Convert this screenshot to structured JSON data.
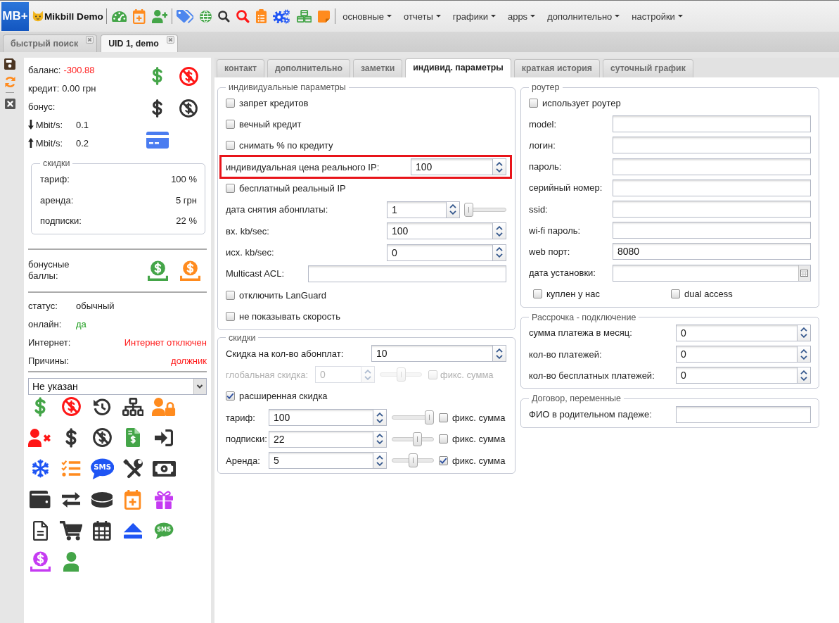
{
  "header": {
    "logo": "MB+",
    "title": "Mikbill Demo",
    "menus": [
      "основные",
      "отчеты",
      "графики",
      "apps",
      "дополнительно",
      "настройки"
    ]
  },
  "window_tabs": [
    {
      "label": "быстрый поиск",
      "selected": false
    },
    {
      "label": "UID 1, demo",
      "selected": true
    }
  ],
  "summary": {
    "balance": {
      "label": "баланс:",
      "value": "-300.88"
    },
    "credit": {
      "label": "кредит:",
      "value": "0.00 грн"
    },
    "bonus": {
      "label": "бонус:"
    },
    "speed_down": {
      "label": "Mbit/s:",
      "value": "0.1"
    },
    "speed_up": {
      "label": "Mbit/s:",
      "value": "0.2"
    },
    "discounts": {
      "legend": "скидки",
      "rows": [
        {
          "label": "тариф:",
          "value": "100 %"
        },
        {
          "label": "аренда:",
          "value": "5 грн"
        },
        {
          "label": "подписки:",
          "value": "22 %"
        }
      ]
    },
    "bonus_points": {
      "label": "бонусные баллы:"
    },
    "status": {
      "label": "статус:",
      "value": "обычный"
    },
    "online": {
      "label": "онлайн:",
      "value": "да"
    },
    "internet": {
      "label": "Интернет:",
      "value": "Интернет отключен"
    },
    "reasons": {
      "label": "Причины:",
      "value": "должник"
    },
    "tariff_select": {
      "value": "Не указан"
    },
    "icon_grid": {
      "sms_labels": [
        "SMS",
        "SMS"
      ]
    }
  },
  "tabs": [
    {
      "label": "контакт",
      "selected": false
    },
    {
      "label": "дополнительно",
      "selected": false
    },
    {
      "label": "заметки",
      "selected": false
    },
    {
      "label": "индивид. параметры",
      "selected": true
    },
    {
      "label": "краткая история",
      "selected": false
    },
    {
      "label": "суточный график",
      "selected": false
    }
  ],
  "individual_params": {
    "legend": "индивидуальные параметры",
    "rows": [
      {
        "kind": "checkbox",
        "label": "запрет кредитов",
        "checked": false
      },
      {
        "kind": "checkbox",
        "label": "вечный кредит",
        "checked": false
      },
      {
        "kind": "checkbox",
        "label": "снимать % по кредиту",
        "checked": false
      },
      {
        "kind": "spinner",
        "label": "индивидуальная цена реального IP:",
        "value": "100",
        "highlighted": true
      },
      {
        "kind": "checkbox",
        "label": "бесплатный реальный IP",
        "checked": false
      },
      {
        "kind": "spinner_slider",
        "label": "дата снятия абонплаты:",
        "value": "1",
        "level": 0
      },
      {
        "kind": "spinner",
        "label": "вх. kb/sec:",
        "value": "100",
        "highlighted": false
      },
      {
        "kind": "spinner",
        "label": "исх. kb/sec:",
        "value": "0",
        "highlighted": false
      },
      {
        "kind": "text",
        "label": "Multicast ACL:"
      },
      {
        "kind": "checkbox",
        "label": "отключить LanGuard",
        "checked": false
      },
      {
        "kind": "checkbox",
        "label": "не показывать скорость",
        "checked": false
      }
    ]
  },
  "discounts": {
    "legend": "скидки",
    "count_discount": {
      "label": "Скидка на кол-во абонплат:",
      "value": "10"
    },
    "global_discount": {
      "label": "глобальная скидка:",
      "value": "0",
      "level": 0.5,
      "disabled": true,
      "fixed": {
        "label": "фикс. сумма",
        "checked": false
      }
    },
    "extended": {
      "label": "расширенная скидка",
      "checked": true
    },
    "rows": [
      {
        "label": "тариф:",
        "value": "100",
        "level": 1,
        "fixed": {
          "label": "фикс. сумма",
          "checked": false
        }
      },
      {
        "label": "подписки:",
        "value": "22",
        "level": 0.64,
        "fixed": {
          "label": "фикс. сумма",
          "checked": false
        }
      },
      {
        "label": "Аренда:",
        "value": "5",
        "level": 0.51,
        "fixed": {
          "label": "фикс. сумма",
          "checked": true
        }
      }
    ]
  },
  "router": {
    "legend": "роутер",
    "uses_router": {
      "label": "использует роутер",
      "checked": false
    },
    "fields": [
      {
        "kind": "text",
        "label": "model:"
      },
      {
        "kind": "text",
        "label": "логин:"
      },
      {
        "kind": "text",
        "label": "пароль:"
      },
      {
        "kind": "text",
        "label": "серийный номер:"
      },
      {
        "kind": "text",
        "label": "ssid:"
      },
      {
        "kind": "text",
        "label": "wi-fi пароль:"
      },
      {
        "kind": "text",
        "label": "web порт:",
        "value": "8080"
      },
      {
        "kind": "date",
        "label": "дата установки:"
      }
    ],
    "options": [
      {
        "label": "куплен у нас",
        "checked": false
      },
      {
        "label": "dual access",
        "checked": false
      }
    ]
  },
  "installment": {
    "legend": "Рассрочка - подключение",
    "fields": [
      {
        "label": "сумма платежа в месяц:",
        "value": "0"
      },
      {
        "label": "кол-во платежей:",
        "value": "0"
      },
      {
        "label": "кол-во бесплатных платежей:",
        "value": "0"
      }
    ]
  },
  "contract": {
    "legend": "Договор, переменные",
    "fields": [
      {
        "label": "ФИО в родительном падеже:"
      }
    ]
  }
}
